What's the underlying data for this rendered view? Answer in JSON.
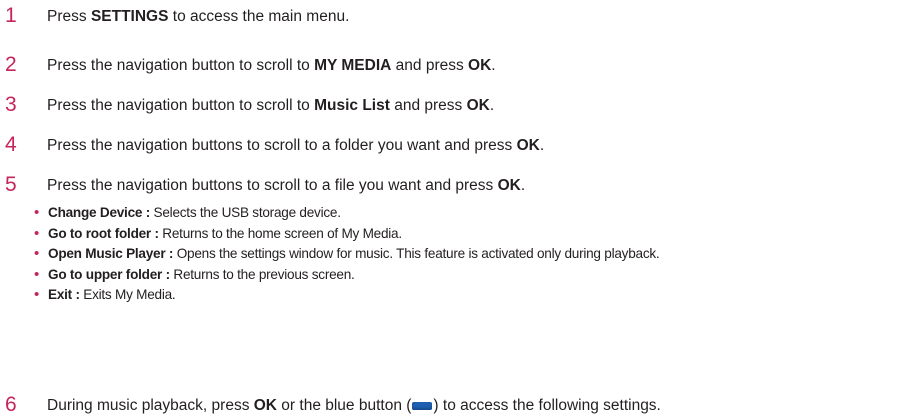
{
  "steps": [
    {
      "num": "1",
      "parts": [
        {
          "text": "Press ",
          "bold": false
        },
        {
          "text": "SETTINGS",
          "bold": true
        },
        {
          "text": " to access the main menu.",
          "bold": false
        }
      ]
    },
    {
      "num": "2",
      "parts": [
        {
          "text": "Press the navigation button to scroll to ",
          "bold": false
        },
        {
          "text": "MY MEDIA",
          "bold": true
        },
        {
          "text": " and press ",
          "bold": false
        },
        {
          "text": "OK",
          "bold": true
        },
        {
          "text": ".",
          "bold": false
        }
      ]
    },
    {
      "num": "3",
      "parts": [
        {
          "text": "Press the navigation button to scroll to ",
          "bold": false
        },
        {
          "text": "Music List",
          "bold": true
        },
        {
          "text": " and press ",
          "bold": false
        },
        {
          "text": "OK",
          "bold": true
        },
        {
          "text": ".",
          "bold": false
        }
      ]
    },
    {
      "num": "4",
      "parts": [
        {
          "text": "Press the navigation buttons to scroll to a folder you want and press ",
          "bold": false
        },
        {
          "text": "OK",
          "bold": true
        },
        {
          "text": ".",
          "bold": false
        }
      ]
    },
    {
      "num": "5",
      "parts": [
        {
          "text": "Press the navigation buttons to scroll to a file you want and press ",
          "bold": false
        },
        {
          "text": "OK",
          "bold": true
        },
        {
          "text": ".",
          "bold": false
        }
      ]
    }
  ],
  "bullets": [
    {
      "term": "Change Device :",
      "desc": " Selects the USB storage device."
    },
    {
      "term": "Go to root folder :",
      "desc": " Returns to the home screen of My Media."
    },
    {
      "term": "Open Music Player :",
      "desc": "  Opens the settings window for music. This feature is activated only during playback."
    },
    {
      "term": "Go to upper folder :",
      "desc": "  Returns to the previous screen."
    },
    {
      "term": "Exit :",
      "desc": " Exits My Media."
    }
  ],
  "bullet_symbol": "•",
  "step6": {
    "num": "6",
    "before": "During music playback, press ",
    "bold": "OK",
    "middle": " or the blue button (",
    "after": ") to access the following settings."
  },
  "colors": {
    "step_number": "#c6245c",
    "bullet": "#c6245c",
    "blue_button": "#1f5fb0"
  }
}
